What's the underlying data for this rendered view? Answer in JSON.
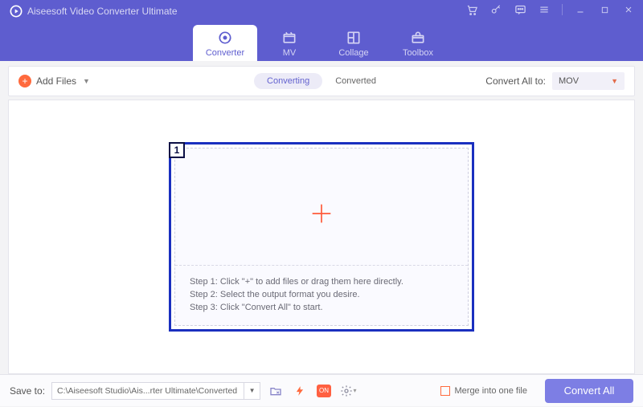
{
  "app_title": "Aiseesoft Video Converter Ultimate",
  "main_tabs": {
    "converter": "Converter",
    "mv": "MV",
    "collage": "Collage",
    "toolbox": "Toolbox"
  },
  "header": {
    "add_files": "Add Files",
    "converting": "Converting",
    "converted": "Converted",
    "convert_all_to": "Convert All to:",
    "format_selected": "MOV"
  },
  "drop": {
    "badge": "1",
    "step1": "Step 1: Click \"+\" to add files or drag them here directly.",
    "step2": "Step 2: Select the output format you desire.",
    "step3": "Step 3: Click \"Convert All\" to start."
  },
  "footer": {
    "save_to_label": "Save to:",
    "path": "C:\\Aiseesoft Studio\\Ais...rter Ultimate\\Converted",
    "gpu_badge": "ON",
    "merge_label": "Merge into one file",
    "convert_button": "Convert All"
  }
}
